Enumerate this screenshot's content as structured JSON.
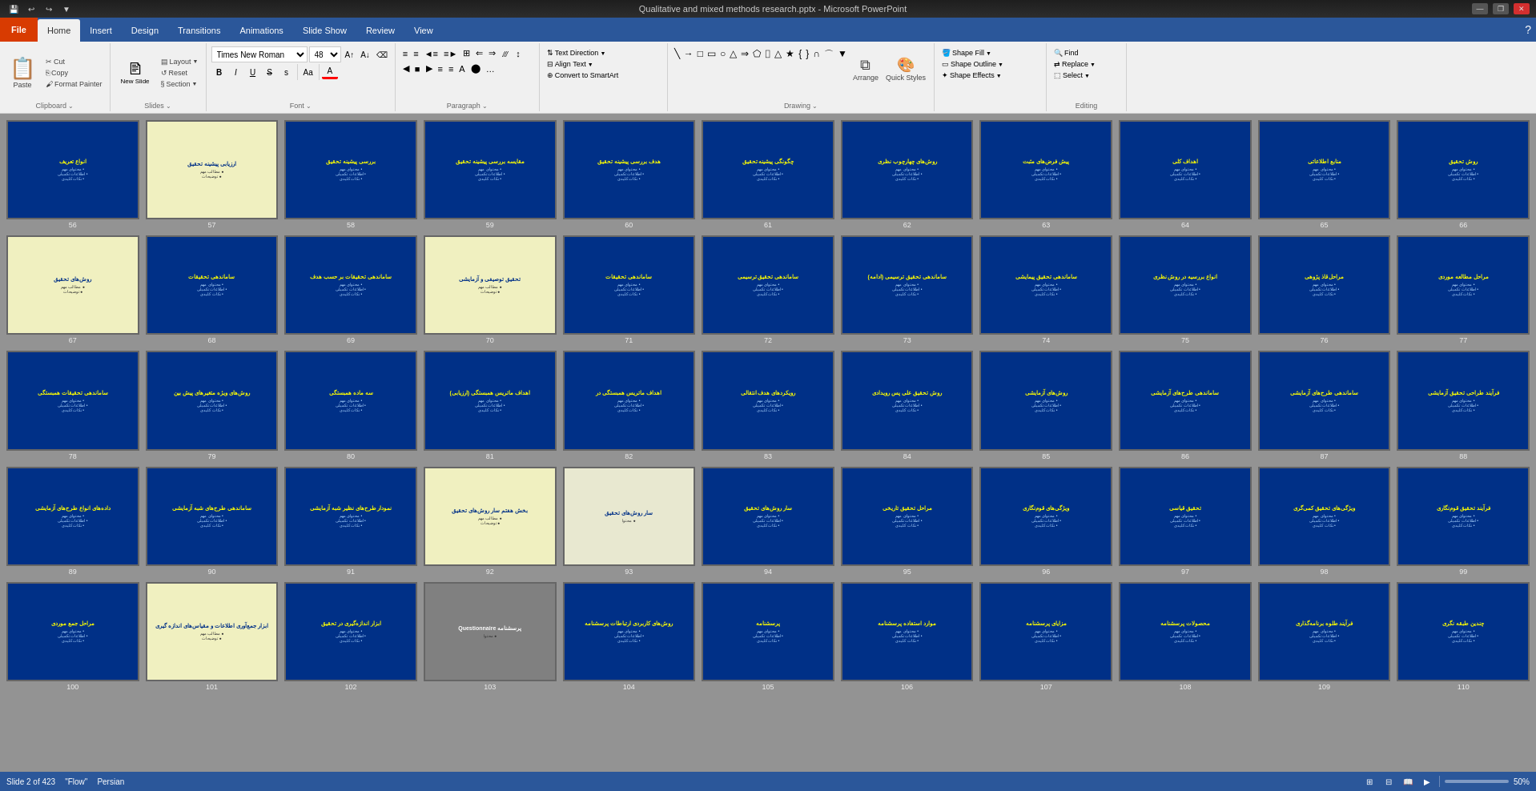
{
  "titlebar": {
    "quickaccess": [
      "save",
      "undo",
      "redo",
      "customize"
    ],
    "title": "Qualitative and mixed methods research.pptx - Microsoft PowerPoint",
    "controls": [
      "minimize",
      "restore",
      "close"
    ]
  },
  "tabs": {
    "file": "File",
    "items": [
      "Home",
      "Insert",
      "Design",
      "Transitions",
      "Animations",
      "Slide Show",
      "Review",
      "View"
    ],
    "active": "Home"
  },
  "ribbon": {
    "clipboard": {
      "label": "Clipboard",
      "paste": "Paste",
      "cut": "Cut",
      "copy": "Copy",
      "format_painter": "Format Painter"
    },
    "slides": {
      "label": "Slides",
      "new_slide": "New Slide",
      "layout": "Layout",
      "reset": "Reset",
      "section": "Section"
    },
    "font": {
      "label": "Font",
      "face": "Times New Roman",
      "size": "48",
      "bold": "B",
      "italic": "I",
      "underline": "U",
      "strikethrough": "S",
      "shadow": "S",
      "change_case": "Aa",
      "color": "A"
    },
    "paragraph": {
      "label": "Paragraph",
      "bullets": "≡",
      "numbering": "≡",
      "decrease_indent": "←",
      "increase_indent": "→",
      "left": "◀",
      "center": "■",
      "right": "▶",
      "justify": "≡",
      "columns": "⫻",
      "line_spacing": "↕"
    },
    "drawing": {
      "label": "Drawing",
      "arrange": "Arrange",
      "quick_styles": "Quick Styles"
    },
    "shape_props": {
      "label": "",
      "fill": "Shape Fill",
      "outline": "Shape Outline",
      "effects": "Shape Effects"
    },
    "text_props": {
      "label": "",
      "direction": "Text Direction",
      "align": "Align Text",
      "convert": "Convert to SmartArt"
    },
    "editing": {
      "label": "Editing",
      "find": "Find",
      "replace": "Replace",
      "select": "Select"
    }
  },
  "slides": [
    {
      "num": 56,
      "bg": "#003087",
      "title": "انواع تعریف",
      "type": "blue"
    },
    {
      "num": 57,
      "bg": "#f0f0c0",
      "title": "ارزیابی پیشینه تحقیق",
      "type": "light"
    },
    {
      "num": 58,
      "bg": "#003087",
      "title": "بررسی پیشینه تحقیق",
      "type": "blue"
    },
    {
      "num": 59,
      "bg": "#003087",
      "title": "مقایسه بررسی پیشینه تحقیق",
      "type": "blue"
    },
    {
      "num": 60,
      "bg": "#003087",
      "title": "هدف بررسی پیشینه تحقیق",
      "type": "blue"
    },
    {
      "num": 61,
      "bg": "#003087",
      "title": "چگونگی پیشینه تحقیق",
      "type": "blue"
    },
    {
      "num": 62,
      "bg": "#003087",
      "title": "روش‌های چهارچوب نظری",
      "type": "blue"
    },
    {
      "num": 63,
      "bg": "#003087",
      "title": "پیش فرض‌های مثبت",
      "type": "blue"
    },
    {
      "num": 64,
      "bg": "#003087",
      "title": "اهداف کلی",
      "type": "blue"
    },
    {
      "num": 65,
      "bg": "#003087",
      "title": "منابع اطلاعاتی",
      "type": "blue"
    },
    {
      "num": 66,
      "bg": "#003087",
      "title": "روش تحقیق",
      "type": "blue"
    },
    {
      "num": 67,
      "bg": "#f0f0c0",
      "title": "روش‌های تحقیق",
      "type": "light"
    },
    {
      "num": 68,
      "bg": "#003087",
      "title": "ساماندهی تحقیقات",
      "type": "blue"
    },
    {
      "num": 69,
      "bg": "#003087",
      "title": "ساماندهی تحقیقات بر حسب هدف",
      "type": "blue"
    },
    {
      "num": 70,
      "bg": "#f0f0c0",
      "title": "تحقیق توصیفی و آزمایشی",
      "type": "light"
    },
    {
      "num": 71,
      "bg": "#003087",
      "title": "ساماندهی تحقیقات",
      "type": "blue"
    },
    {
      "num": 72,
      "bg": "#003087",
      "title": "ساماندهی تحقیق ترسیمی",
      "type": "blue"
    },
    {
      "num": 73,
      "bg": "#003087",
      "title": "ساماندهی تحقیق ترسیمی (ادامه)",
      "type": "blue"
    },
    {
      "num": 74,
      "bg": "#003087",
      "title": "ساماندهی تحقیق پیمایشی",
      "type": "blue"
    },
    {
      "num": 75,
      "bg": "#003087",
      "title": "انواع بررسیه در روش نظری",
      "type": "blue"
    },
    {
      "num": 76,
      "bg": "#003087",
      "title": "مراحل قاذ پژوهی",
      "type": "blue"
    },
    {
      "num": 77,
      "bg": "#003087",
      "title": "مراحل مطالعه موردی",
      "type": "blue"
    },
    {
      "num": 78,
      "bg": "#003087",
      "title": "ساماندهی تحقیقات همبستگی",
      "type": "blue"
    },
    {
      "num": 79,
      "bg": "#003087",
      "title": "روش‌های ویژه متغیرهای پیش بین",
      "type": "blue"
    },
    {
      "num": 80,
      "bg": "#003087",
      "title": "سه ماده همبستگی",
      "type": "blue"
    },
    {
      "num": 81,
      "bg": "#003087",
      "title": "اهداف ماتریس همبستگی (ارزیابی)",
      "type": "blue"
    },
    {
      "num": 82,
      "bg": "#003087",
      "title": "اهداف ماتریس همبستگی در",
      "type": "blue"
    },
    {
      "num": 83,
      "bg": "#003087",
      "title": "رویکردهای هدف انتقالی",
      "type": "blue"
    },
    {
      "num": 84,
      "bg": "#003087",
      "title": "روش تحقیق علی پس رویدادی",
      "type": "blue"
    },
    {
      "num": 85,
      "bg": "#003087",
      "title": "روش‌های آزمایشی",
      "type": "blue"
    },
    {
      "num": 86,
      "bg": "#003087",
      "title": "ساماندهی طرح‌های آزمایشی",
      "type": "blue"
    },
    {
      "num": 87,
      "bg": "#003087",
      "title": "ساماندهی طرح‌های آزمایشی",
      "type": "blue"
    },
    {
      "num": 88,
      "bg": "#003087",
      "title": "فرآیند طراحی تحقیق آزمایشی",
      "type": "blue"
    },
    {
      "num": 89,
      "bg": "#003087",
      "title": "داده‌های انواع طرح‌های آزمایشی",
      "type": "blue"
    },
    {
      "num": 90,
      "bg": "#003087",
      "title": "ساماندهی طرح‌های شبه آزمایشی",
      "type": "blue"
    },
    {
      "num": 91,
      "bg": "#003087",
      "title": "نمودار طرح‌های نظیر شبه آزمایشی",
      "type": "blue"
    },
    {
      "num": 92,
      "bg": "#f0f0c0",
      "title": "بخش هفتم سار روش‌های تحقیق",
      "type": "light"
    },
    {
      "num": 93,
      "bg": "#f0f0c0",
      "title": "سار روش‌های تحقیق",
      "type": "light2"
    },
    {
      "num": 94,
      "bg": "#003087",
      "title": "سار روش‌های تحقیق",
      "type": "blue"
    },
    {
      "num": 95,
      "bg": "#003087",
      "title": "مراحل تحقیق تاریخی",
      "type": "blue"
    },
    {
      "num": 96,
      "bg": "#003087",
      "title": "ویژگی‌های قوم‌نگاری",
      "type": "blue"
    },
    {
      "num": 97,
      "bg": "#003087",
      "title": "تحقیق قیاسی",
      "type": "blue"
    },
    {
      "num": 98,
      "bg": "#003087",
      "title": "ویژگی‌های تحقیق کمی‌گری",
      "type": "blue"
    },
    {
      "num": 99,
      "bg": "#003087",
      "title": "فرآیند تحقیق قوم‌نگاری",
      "type": "blue"
    },
    {
      "num": 100,
      "bg": "#003087",
      "title": "مراحل جمع موردی",
      "type": "blue"
    },
    {
      "num": 101,
      "bg": "#f0f0c0",
      "title": "ابزار جمع‌آوری اطلاعات و مقیاس‌های اندازه گیری",
      "type": "light"
    },
    {
      "num": 102,
      "bg": "#003087",
      "title": "ابزار اندازه‌گیری در تحقیق",
      "type": "blue"
    },
    {
      "num": 103,
      "bg": "#808080",
      "title": "پرسشنامه Questionnaire",
      "type": "gray"
    },
    {
      "num": 104,
      "bg": "#003087",
      "title": "روش‌های کاربردی ارتباطات پرسشنامه",
      "type": "blue"
    },
    {
      "num": 105,
      "bg": "#003087",
      "title": "پرسشنامه",
      "type": "blue"
    },
    {
      "num": 106,
      "bg": "#003087",
      "title": "موارد استفاده پرسشنامه",
      "type": "blue"
    },
    {
      "num": 107,
      "bg": "#003087",
      "title": "مزایای پرسشنامه",
      "type": "blue"
    },
    {
      "num": 108,
      "bg": "#003087",
      "title": "محصولات پرسشنامه",
      "type": "blue"
    },
    {
      "num": 109,
      "bg": "#003087",
      "title": "فرآیند طلوه برنامه‌گذاری",
      "type": "blue"
    },
    {
      "num": 110,
      "bg": "#003087",
      "title": "چندین طبقه نگری",
      "type": "blue"
    }
  ],
  "status": {
    "slide_info": "Slide 2 of 423",
    "flow": "\"Flow\"",
    "lang": "Persian",
    "zoom": "50%"
  }
}
